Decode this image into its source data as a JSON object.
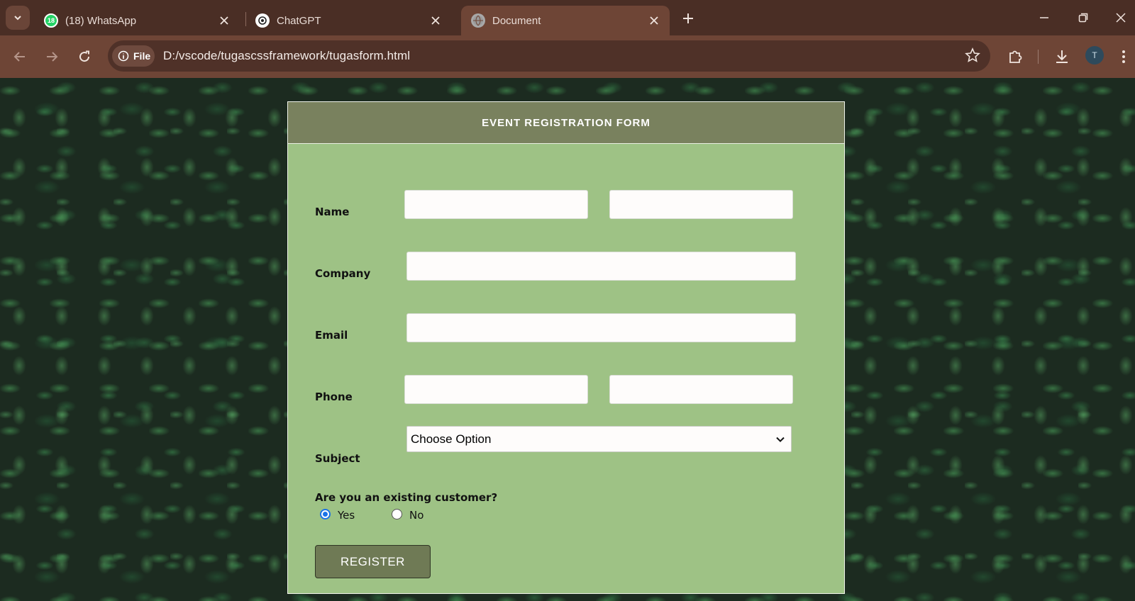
{
  "browser": {
    "tabs": [
      {
        "title": "(18) WhatsApp",
        "badge": "18",
        "icon": "whatsapp-icon"
      },
      {
        "title": "ChatGPT",
        "icon": "chatgpt-icon"
      },
      {
        "title": "Document",
        "icon": "globe-icon",
        "active": true
      }
    ],
    "address": {
      "scheme_chip": "File",
      "url": "D:/vscode/tugascssframework/tugasform.html"
    },
    "avatar_initial": "T"
  },
  "form": {
    "title": "EVENT REGISTRATION FORM",
    "fields": {
      "name_label": "Name",
      "company_label": "Company",
      "email_label": "Email",
      "phone_label": "Phone",
      "subject_label": "Subject"
    },
    "subject_select": {
      "selected": "Choose Option"
    },
    "customer_question": "Are you an existing customer?",
    "radio_options": [
      {
        "label": "Yes",
        "checked": true
      },
      {
        "label": "No",
        "checked": false
      }
    ],
    "submit_label": "REGISTER"
  },
  "colors": {
    "card_background": "#9ec285",
    "header_background": "#79815e",
    "button_background": "#6f7a55",
    "browser_chrome": "#6e4536",
    "radio_accent": "#1a73e8"
  }
}
